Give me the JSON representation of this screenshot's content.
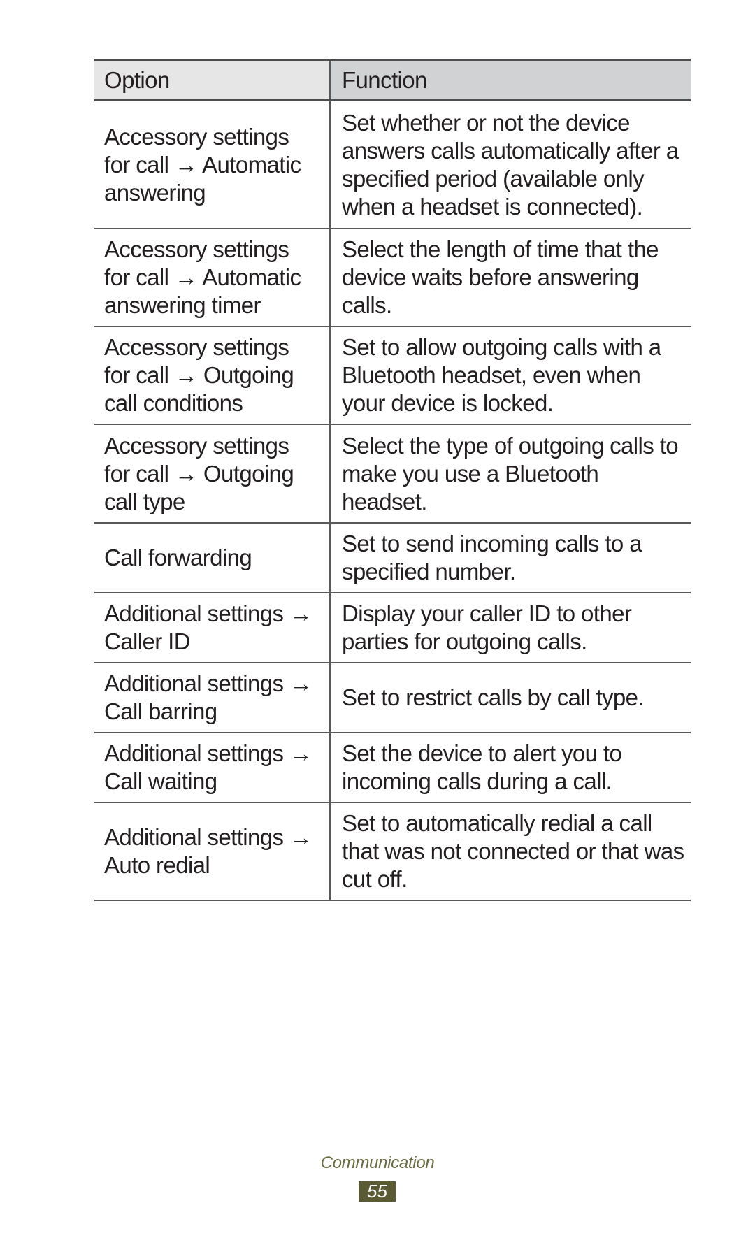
{
  "table": {
    "headers": {
      "option": "Option",
      "function": "Function"
    },
    "rows": [
      {
        "option": "Accessory settings for call → Automatic answering",
        "function": "Set whether or not the device answers calls automatically after a specified period (available only when a headset is connected)."
      },
      {
        "option": "Accessory settings for call → Automatic answering timer",
        "function": "Select the length of time that the device waits before answering calls."
      },
      {
        "option": "Accessory settings for call → Outgoing call conditions",
        "function": "Set to allow outgoing calls with a Bluetooth headset, even when your device is locked."
      },
      {
        "option": "Accessory settings for call → Outgoing call type",
        "function": "Select the type of outgoing calls to make you use a Bluetooth headset."
      },
      {
        "option": "Call forwarding",
        "function": "Set to send incoming calls to a specified number."
      },
      {
        "option": "Additional settings → Caller ID",
        "function": "Display your caller ID to other parties for outgoing calls."
      },
      {
        "option": "Additional settings → Call barring",
        "function": "Set to restrict calls by call type."
      },
      {
        "option": "Additional settings → Call waiting",
        "function": "Set the device to alert you to incoming calls during a call."
      },
      {
        "option": "Additional settings → Auto redial",
        "function": "Set to automatically redial a call that was not connected or that was cut off."
      }
    ]
  },
  "footer": {
    "section": "Communication",
    "page_number": "55"
  },
  "colors": {
    "header_option_bg": "#e6e6e6",
    "header_function_bg": "#d1d2d4",
    "footer_accent": "#5a5a34"
  }
}
